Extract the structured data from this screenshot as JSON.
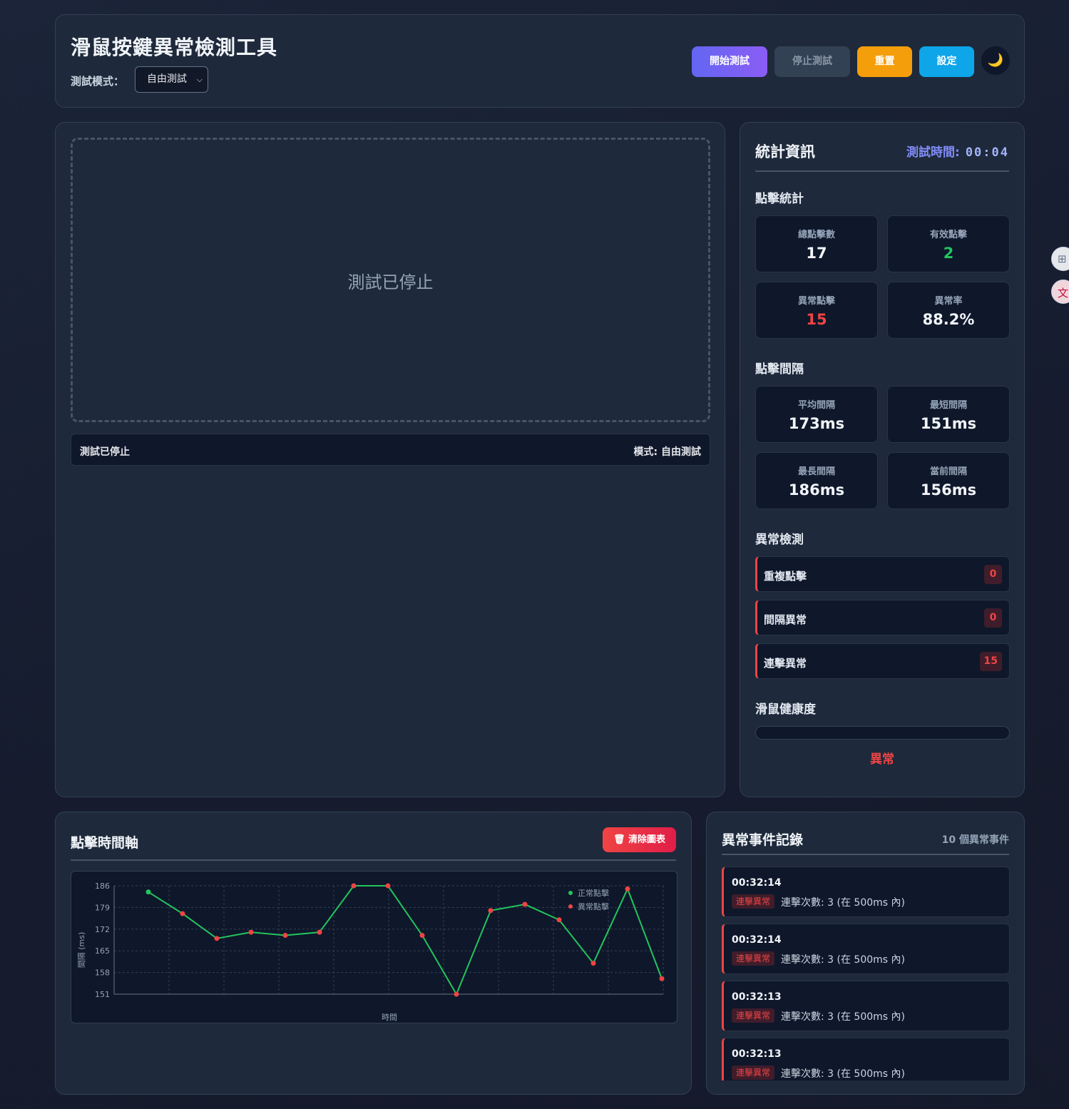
{
  "header": {
    "title": "滑鼠按鍵異常檢測工具",
    "mode_label": "測試模式：",
    "mode_selected": "自由測試",
    "buttons": {
      "start": "開始測試",
      "stop": "停止測試",
      "reset": "重置",
      "settings": "設定"
    },
    "theme_icon": "🌙"
  },
  "test_area": {
    "message": "測試已停止",
    "status_left": "測試已停止",
    "status_right": "模式: 自由測試"
  },
  "stats": {
    "title": "統計資訊",
    "time_label": "測試時間:",
    "time_value": "00:04",
    "click_section": "點擊統計",
    "total_label": "總點擊數",
    "total_value": "17",
    "valid_label": "有效點擊",
    "valid_value": "2",
    "abnormal_label": "異常點擊",
    "abnormal_value": "15",
    "rate_label": "異常率",
    "rate_value": "88.2%",
    "interval_section": "點擊間隔",
    "avg_label": "平均間隔",
    "avg_value": "173ms",
    "min_label": "最短間隔",
    "min_value": "151ms",
    "max_label": "最長間隔",
    "max_value": "186ms",
    "cur_label": "當前間隔",
    "cur_value": "156ms",
    "anomaly_section": "異常檢測",
    "anomalies": [
      {
        "label": "重複點擊",
        "count": "0"
      },
      {
        "label": "間隔異常",
        "count": "0"
      },
      {
        "label": "連擊異常",
        "count": "15"
      }
    ],
    "health_section": "滑鼠健康度",
    "health_fraction": 0,
    "health_text": "異常"
  },
  "timeline": {
    "title": "點擊時間軸",
    "clear_icon": "trash-icon",
    "clear_label": "清除圖表"
  },
  "chart_data": {
    "type": "line",
    "ylabel": "間隔 (ms)",
    "xlabel": "時間",
    "yticks": [
      186,
      179,
      172,
      165,
      158,
      151
    ],
    "ylim": [
      151,
      186
    ],
    "grid": true,
    "legend_position": "top-right",
    "legend": [
      {
        "name": "正常點擊",
        "color": "#22c55e"
      },
      {
        "name": "異常點擊",
        "color": "#ef4444"
      }
    ],
    "line_color": "#22c55e",
    "points": [
      {
        "y": 184,
        "status": "normal"
      },
      {
        "y": 177,
        "status": "abnormal"
      },
      {
        "y": 169,
        "status": "abnormal"
      },
      {
        "y": 171,
        "status": "abnormal"
      },
      {
        "y": 170,
        "status": "abnormal"
      },
      {
        "y": 171,
        "status": "abnormal"
      },
      {
        "y": 186,
        "status": "abnormal"
      },
      {
        "y": 186,
        "status": "abnormal"
      },
      {
        "y": 170,
        "status": "abnormal"
      },
      {
        "y": 151,
        "status": "abnormal"
      },
      {
        "y": 178,
        "status": "abnormal"
      },
      {
        "y": 180,
        "status": "abnormal"
      },
      {
        "y": 175,
        "status": "abnormal"
      },
      {
        "y": 161,
        "status": "abnormal"
      },
      {
        "y": 185,
        "status": "abnormal"
      },
      {
        "y": 156,
        "status": "abnormal"
      }
    ]
  },
  "events": {
    "title": "異常事件記錄",
    "count_text": "10 個異常事件",
    "items": [
      {
        "time": "00:32:14",
        "tag": "連擊異常",
        "desc": "連擊次數: 3 (在 500ms 內)"
      },
      {
        "time": "00:32:14",
        "tag": "連擊異常",
        "desc": "連擊次數: 3 (在 500ms 內)"
      },
      {
        "time": "00:32:13",
        "tag": "連擊異常",
        "desc": "連擊次數: 3 (在 500ms 內)"
      },
      {
        "time": "00:32:13",
        "tag": "連擊異常",
        "desc": "連擊次數: 3 (在 500ms 內)"
      }
    ]
  },
  "side_widgets": {
    "grid_icon": "⊞",
    "translate_icon": "文"
  }
}
